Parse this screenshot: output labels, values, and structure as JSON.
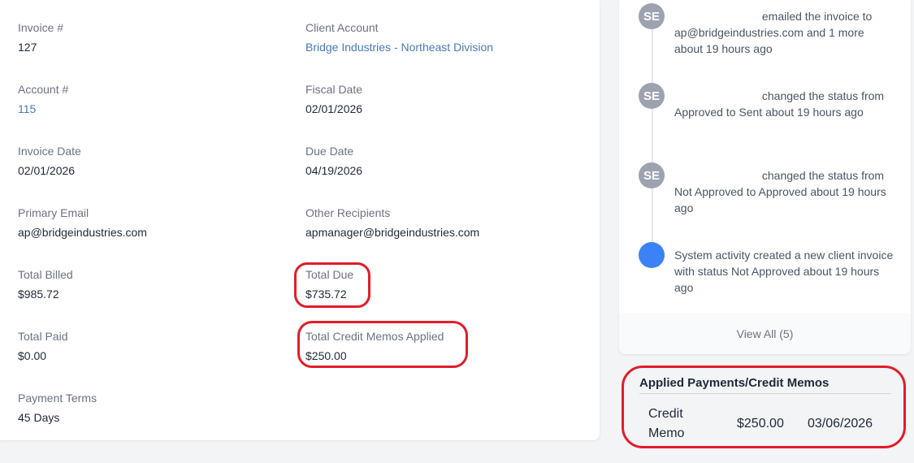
{
  "invoice_details": {
    "invoice_number": {
      "label": "Invoice #",
      "value": "127"
    },
    "client_account": {
      "label": "Client Account",
      "value": "Bridge Industries - Northeast Division"
    },
    "account_number": {
      "label": "Account #",
      "value": "115"
    },
    "fiscal_date": {
      "label": "Fiscal Date",
      "value": "02/01/2026"
    },
    "invoice_date": {
      "label": "Invoice Date",
      "value": "02/01/2026"
    },
    "due_date": {
      "label": "Due Date",
      "value": "04/19/2026"
    },
    "primary_email": {
      "label": "Primary Email",
      "value": "ap@bridgeindustries.com"
    },
    "other_recipients": {
      "label": "Other Recipients",
      "value": "apmanager@bridgeindustries.com"
    },
    "total_billed": {
      "label": "Total Billed",
      "value": "$985.72"
    },
    "total_due": {
      "label": "Total Due",
      "value": "$735.72"
    },
    "total_paid": {
      "label": "Total Paid",
      "value": "$0.00"
    },
    "total_credit_memos": {
      "label": "Total Credit Memos Applied",
      "value": "$250.00"
    },
    "payment_terms": {
      "label": "Payment Terms",
      "value": "45 Days"
    }
  },
  "activity": {
    "items": [
      {
        "avatar": "SE",
        "text": "emailed the invoice to ap@bridgeindustries.com and 1 more about 19 hours ago"
      },
      {
        "avatar": "SE",
        "text": "changed the status from Approved to Sent about 19 hours ago"
      },
      {
        "avatar": "SE",
        "text": "changed the status from Not Approved to Approved about 19 hours ago"
      },
      {
        "avatar": "",
        "text": "System activity created a new client invoice with status Not Approved about 19 hours ago"
      }
    ],
    "view_all_label": "View All (5)"
  },
  "payments": {
    "title": "Applied Payments/Credit Memos",
    "rows": [
      {
        "type": "Credit Memo",
        "amount": "$250.00",
        "date": "03/06/2026"
      }
    ]
  },
  "colors": {
    "link": "#4a7ab6",
    "annotation": "#e11d2a",
    "system_avatar": "#3b82f6",
    "user_avatar": "#9ca3af"
  }
}
